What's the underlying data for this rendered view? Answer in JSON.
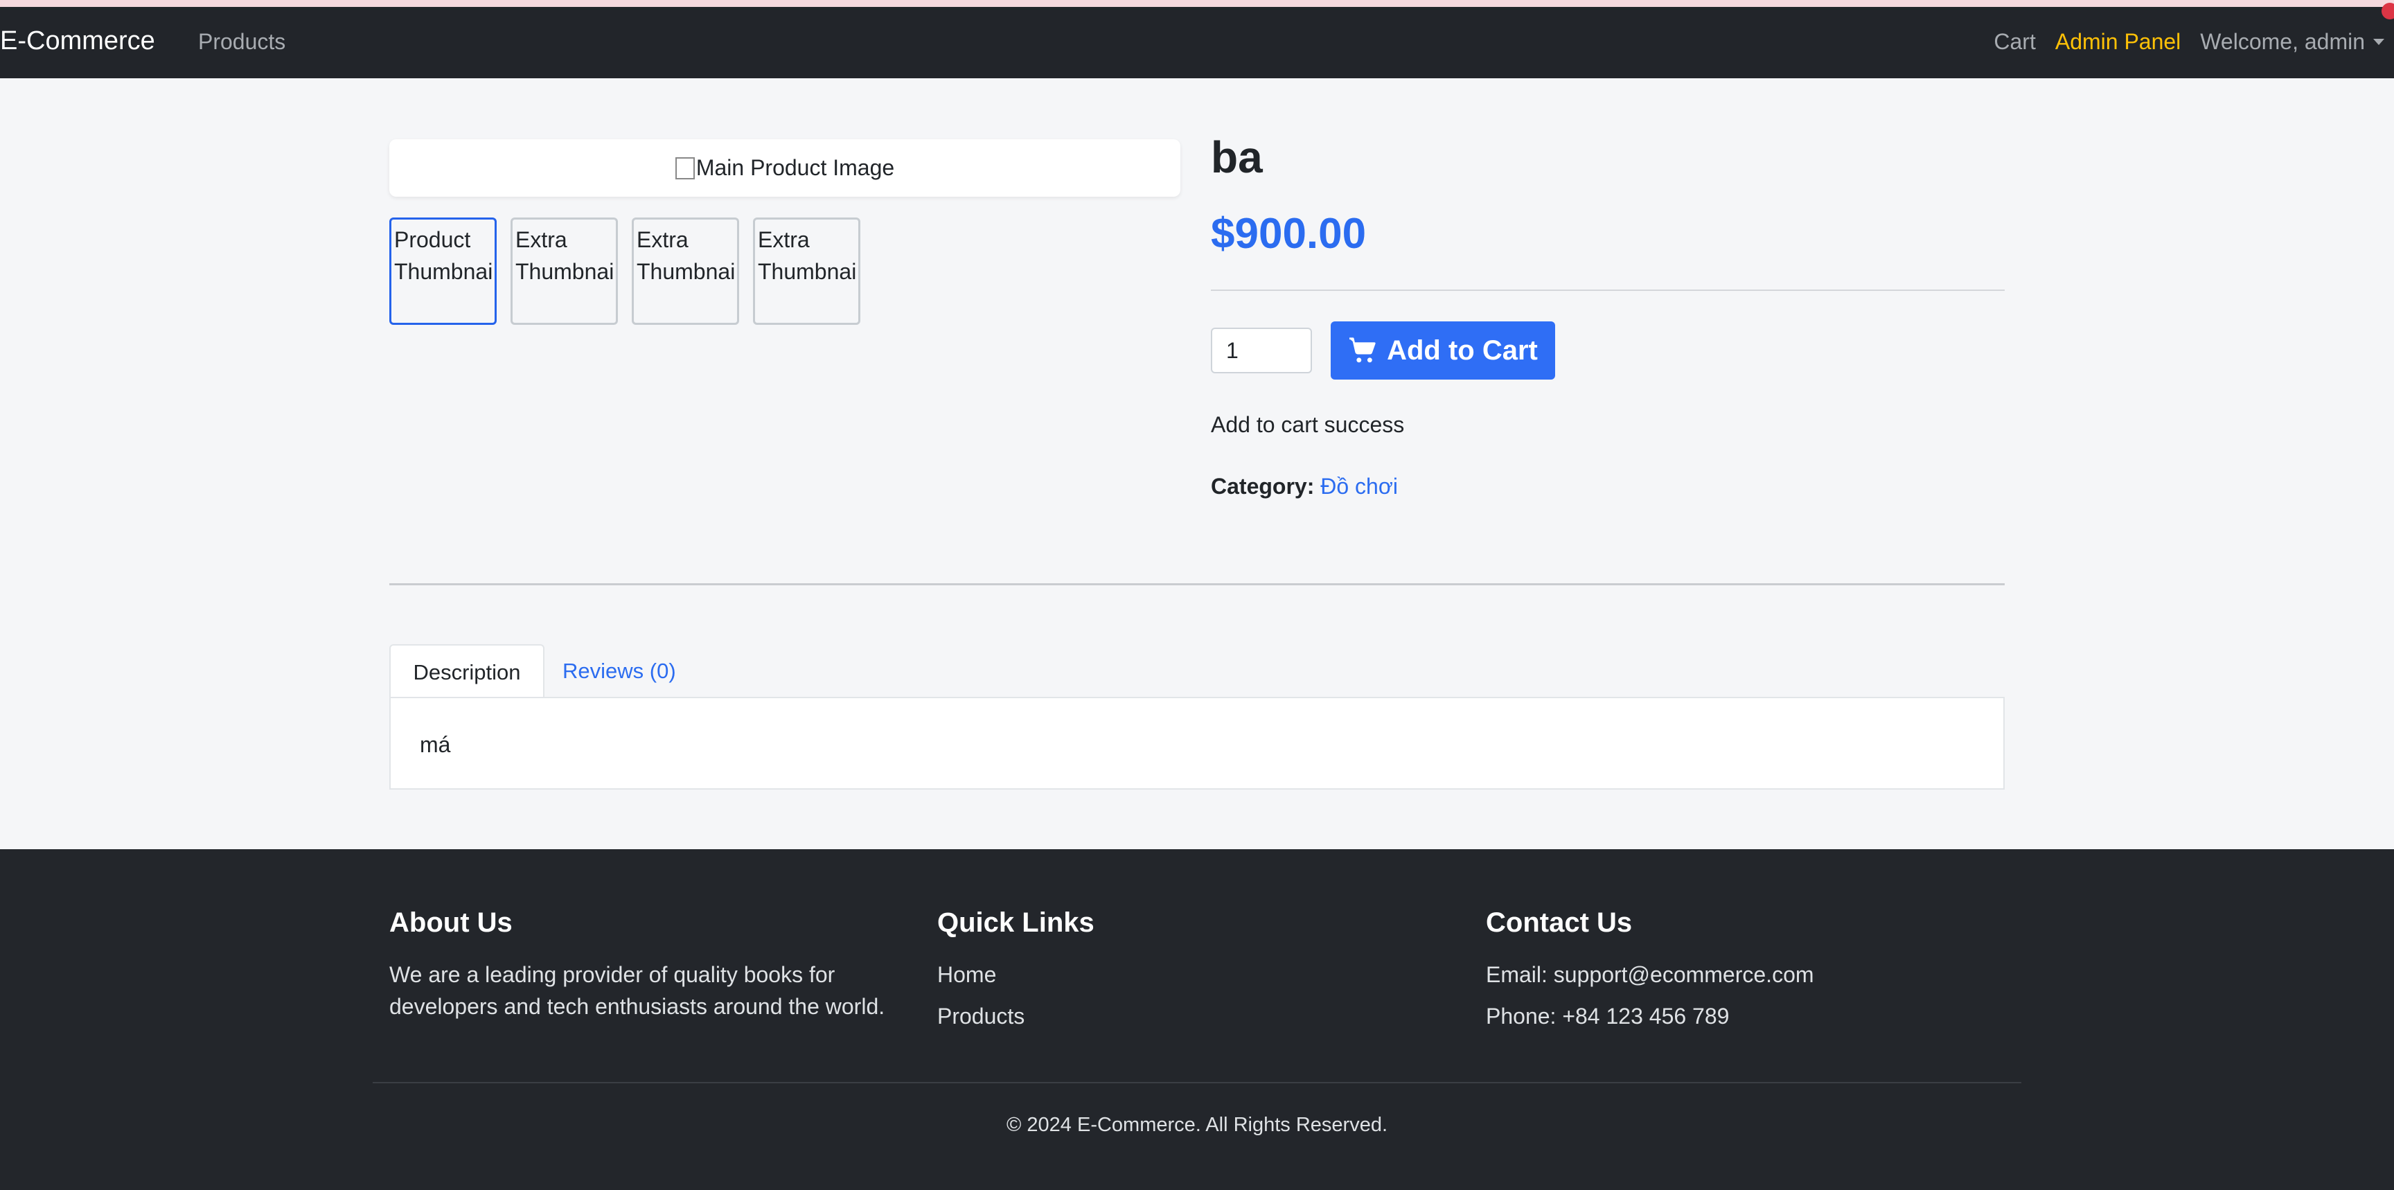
{
  "navbar": {
    "brand": "E-Commerce",
    "products": "Products",
    "cart": "Cart",
    "admin": "Admin Panel",
    "user": "Welcome, admin"
  },
  "product": {
    "main_image_alt": "Main Product Image",
    "thumbnails": [
      {
        "line1": "Product",
        "line2": "Thumbnai"
      },
      {
        "line1": "Extra",
        "line2": "Thumbnai"
      },
      {
        "line1": "Extra",
        "line2": "Thumbnai"
      },
      {
        "line1": "Extra",
        "line2": "Thumbnai"
      }
    ],
    "title": "ba",
    "price": "$900.00",
    "quantity": "1",
    "add_to_cart": "Add to Cart",
    "message": "Add to cart success",
    "category_label": "Category:",
    "category_value": "Đồ chơi"
  },
  "tabs": {
    "description": "Description",
    "reviews": "Reviews (0)",
    "description_text": "má"
  },
  "footer": {
    "about_title": "About Us",
    "about_line1": "We are a leading provider of quality books for",
    "about_line2": "developers and tech enthusiasts around the world.",
    "links_title": "Quick Links",
    "link_home": "Home",
    "link_products": "Products",
    "contact_title": "Contact Us",
    "email": "Email: support@ecommerce.com",
    "phone": "Phone: +84 123 456 789",
    "copyright": "© 2024 E-Commerce. All Rights Reserved."
  },
  "colors": {
    "accent": "#2f6ef5",
    "admin": "#ffc107",
    "navbar": "#22252a",
    "footer": "#23262b"
  }
}
